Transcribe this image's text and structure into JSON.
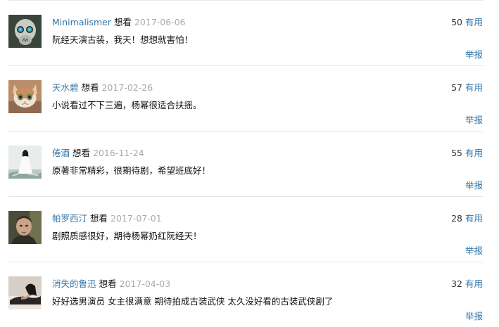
{
  "comments": [
    {
      "username": "Minimalismer",
      "status": "想看",
      "date": "2017-06-06",
      "votes": "50",
      "useful_label": "有用",
      "content": "阮经天演古装，我天！想想就害怕！",
      "report_label": "举报",
      "avatar_icon": "skull-with-roses-avatar"
    },
    {
      "username": "天水碧",
      "status": "想看",
      "date": "2017-02-26",
      "votes": "57",
      "useful_label": "有用",
      "content": "小说看过不下三遍，杨幂很适合扶摇。",
      "report_label": "举报",
      "avatar_icon": "kitten-avatar"
    },
    {
      "username": "倦酒",
      "status": "想看",
      "date": "2016-11-24",
      "votes": "55",
      "useful_label": "有用",
      "content": "原著非常精彩，很期待剧，希望班底好！",
      "report_label": "举报",
      "avatar_icon": "ink-painting-figure-avatar"
    },
    {
      "username": "帕罗西汀",
      "status": "想看",
      "date": "2017-07-01",
      "votes": "28",
      "useful_label": "有用",
      "content": "剧照质感很好，期待杨幂奶红阮经天！",
      "report_label": "举报",
      "avatar_icon": "man-portrait-avatar"
    },
    {
      "username": "消失的鲁迅",
      "status": "想看",
      "date": "2017-04-03",
      "votes": "32",
      "useful_label": "有用",
      "content": "好好选男演员 女主很满意 期待拍成古装武侠 太久没好看的古装武侠剧了",
      "report_label": "举报",
      "avatar_icon": "reclining-woman-avatar"
    }
  ]
}
